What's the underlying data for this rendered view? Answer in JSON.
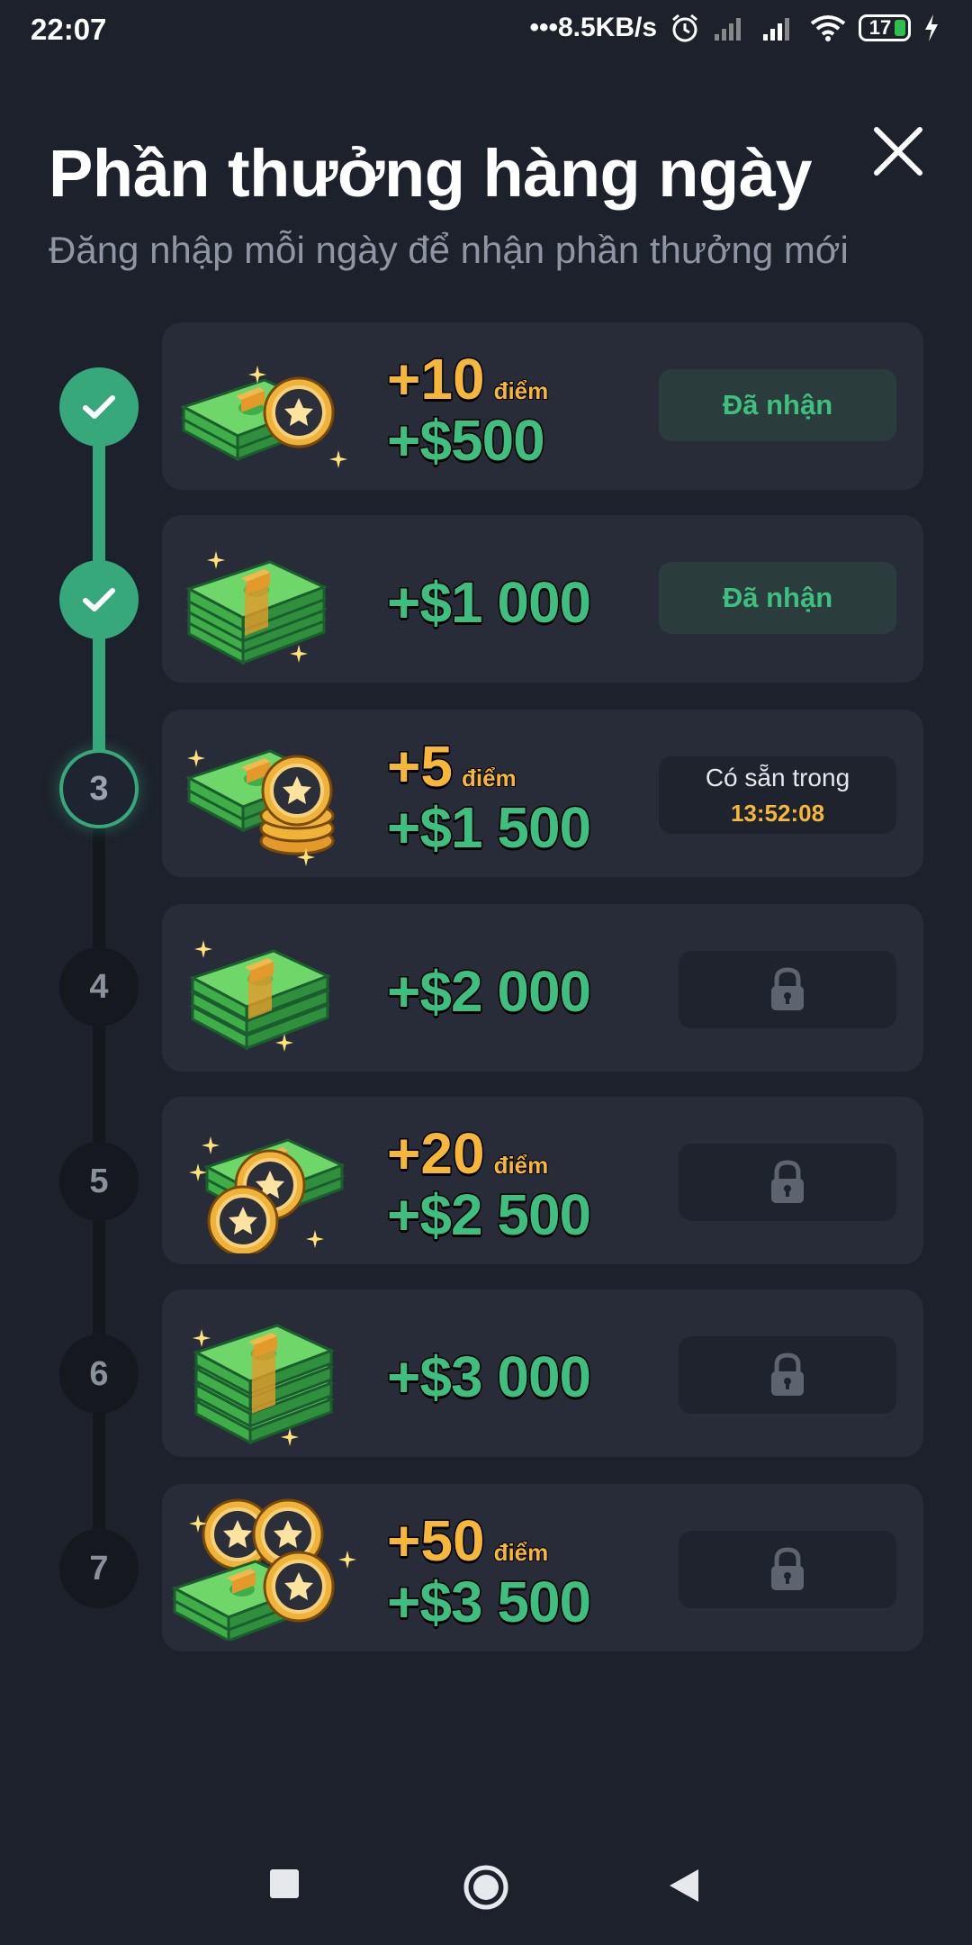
{
  "status_bar": {
    "time": "22:07",
    "network_speed": "•••8.5KB/s",
    "battery_level": "17",
    "icons": [
      "alarm-icon",
      "signal-icon",
      "signal-icon",
      "wifi-icon",
      "battery-icon",
      "charging-icon"
    ]
  },
  "header": {
    "title": "Phần thưởng hàng ngày",
    "subtitle": "Đăng nhập mỗi ngày để nhận phần thưởng mới",
    "close_icon": "close-icon"
  },
  "days": [
    {
      "day": "1",
      "state": "claimed",
      "points": "+10",
      "points_label": "điểm",
      "cash": "+$500",
      "action_label": "Đã nhận",
      "art": "cash-coin"
    },
    {
      "day": "2",
      "state": "claimed",
      "points": "",
      "points_label": "",
      "cash": "+$1 000",
      "action_label": "Đã nhận",
      "art": "cash-stack"
    },
    {
      "day": "3",
      "state": "current",
      "points": "+5",
      "points_label": "điểm",
      "cash": "+$1 500",
      "action_label": "Có sẵn trong",
      "timer": "13:52:08",
      "art": "cash-coins"
    },
    {
      "day": "4",
      "state": "locked",
      "points": "",
      "points_label": "",
      "cash": "+$2 000",
      "art": "cash-stack"
    },
    {
      "day": "5",
      "state": "locked",
      "points": "+20",
      "points_label": "điểm",
      "cash": "+$2 500",
      "art": "cash-coins"
    },
    {
      "day": "6",
      "state": "locked",
      "points": "",
      "points_label": "",
      "cash": "+$3 000",
      "art": "cash-stack"
    },
    {
      "day": "7",
      "state": "locked",
      "points": "+50",
      "points_label": "điểm",
      "cash": "+$3 500",
      "art": "cash-coins"
    }
  ],
  "colors": {
    "background": "#1d212b",
    "card": "#272c38",
    "accent_green": "#36a87c",
    "cash_green": "#3fbf7f",
    "points_gold": "#f6b63a"
  },
  "nav_bar": {
    "icons": [
      "recents-square-icon",
      "home-circle-icon",
      "back-triangle-icon"
    ]
  }
}
